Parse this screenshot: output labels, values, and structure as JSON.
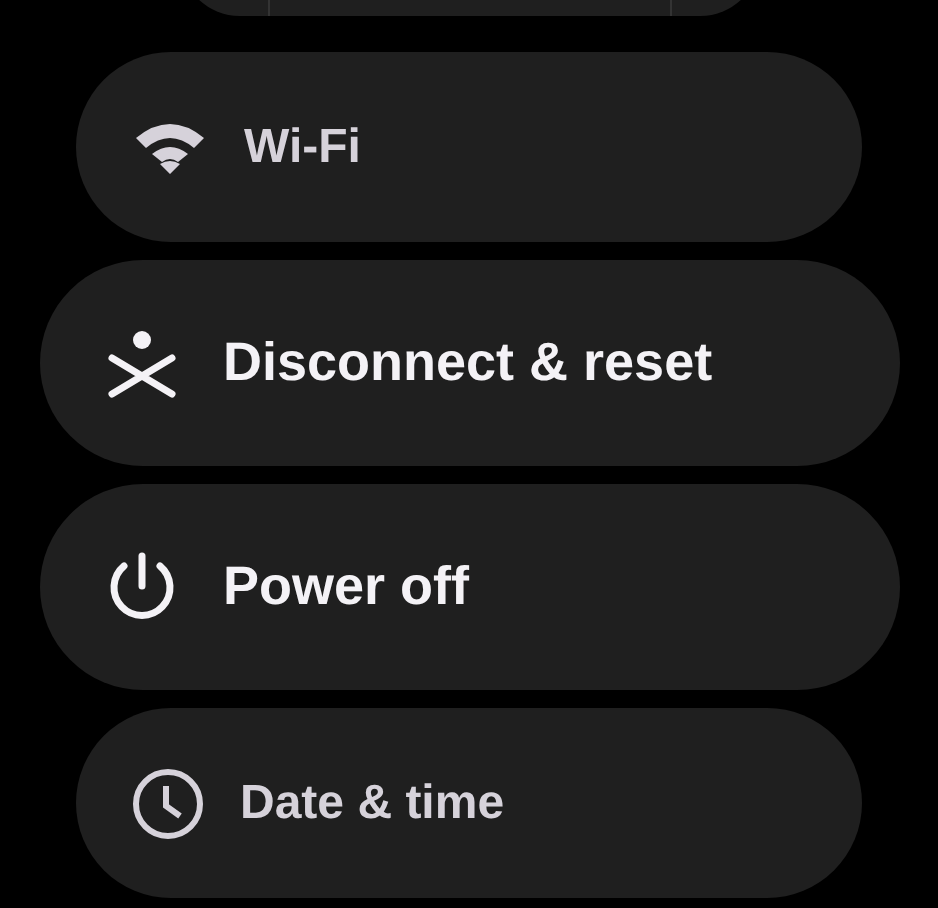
{
  "items": [
    {
      "label": "Wi-Fi",
      "kind": "edge"
    },
    {
      "label": "Disconnect & reset",
      "kind": "center"
    },
    {
      "label": "Power off",
      "kind": "center"
    },
    {
      "label": "Date & time",
      "kind": "edge"
    }
  ]
}
